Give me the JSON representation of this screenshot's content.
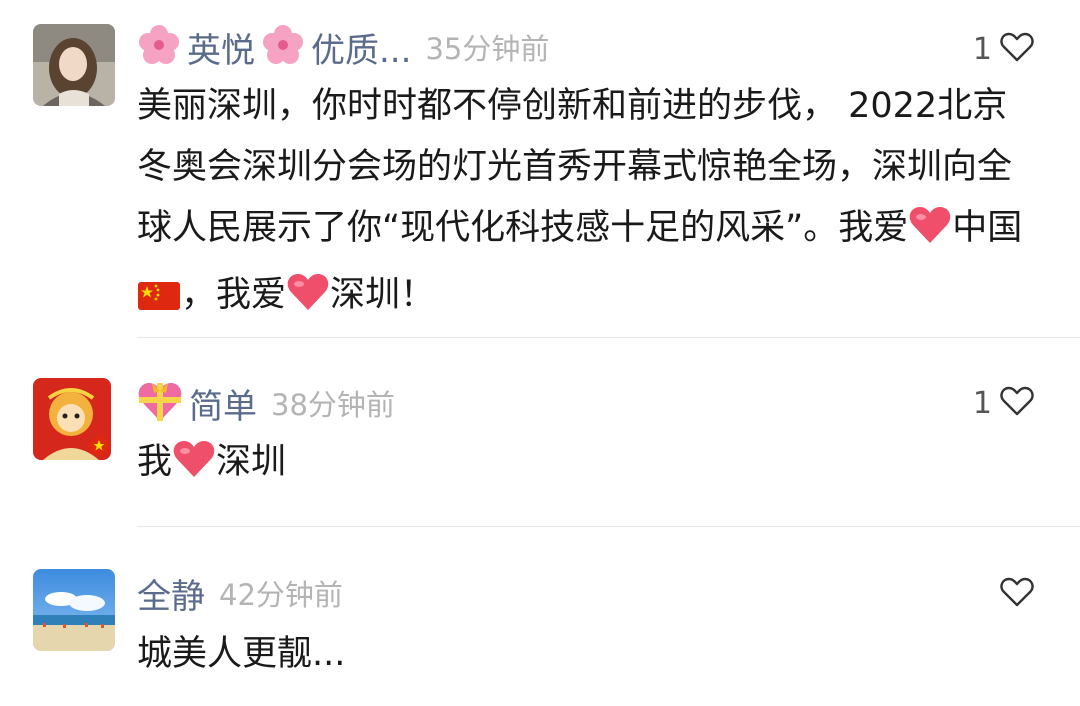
{
  "comments": [
    {
      "name": "英悦",
      "name_suffix": "优质...",
      "time": "35分钟前",
      "likes": "1",
      "text_parts": [
        "美丽深圳，你时时都不停创新和前进的步伐，  2022北京冬奥会深圳分会场的灯光首秀开幕式惊艳全场，深圳向全球人民展示了你“现代化科技感十足的风采”。我爱",
        "中国",
        "，我爱",
        "深圳！"
      ]
    },
    {
      "name": "简单",
      "time": "38分钟前",
      "likes": "1",
      "text_parts": [
        "我",
        "深圳"
      ]
    },
    {
      "name": "全静",
      "time": "42分钟前",
      "likes": "",
      "text": "城美人更靓..."
    }
  ],
  "colors": {
    "name": "#5b6b8c",
    "time": "#b4b4b4",
    "text": "#1a1a1a",
    "heart_emoji": "#ef4f6b",
    "flag": "#de2910",
    "divider": "#e9e9e9"
  },
  "icons": {
    "like": "heart-outline-icon",
    "name_emoji_1": "cherry-blossom-icon",
    "name_emoji_2": "heart-gift-icon",
    "inline_heart": "red-heart-emoji",
    "inline_flag": "china-flag-emoji"
  }
}
